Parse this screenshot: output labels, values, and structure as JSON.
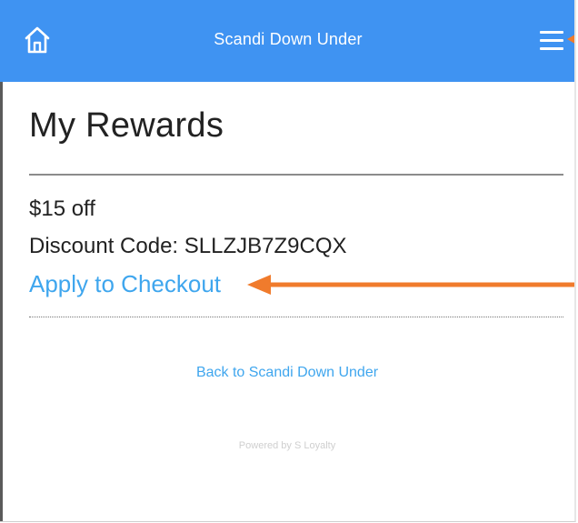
{
  "header": {
    "title": "Scandi Down Under",
    "home_icon": "home-icon",
    "menu_icon": "hamburger-menu-icon",
    "background_color": "#3f93f2"
  },
  "page": {
    "title": "My Rewards"
  },
  "reward": {
    "amount": "$15 off",
    "discount_code_line": "Discount Code: SLLZJB7Z9CQX",
    "apply_link": "Apply to Checkout"
  },
  "footer": {
    "back_link": "Back to Scandi Down Under",
    "powered_by": "Powered by S Loyalty"
  },
  "annotations": {
    "arrow_color": "#f07b2c"
  },
  "colors": {
    "link": "#3fa6ee",
    "text": "#222222"
  }
}
